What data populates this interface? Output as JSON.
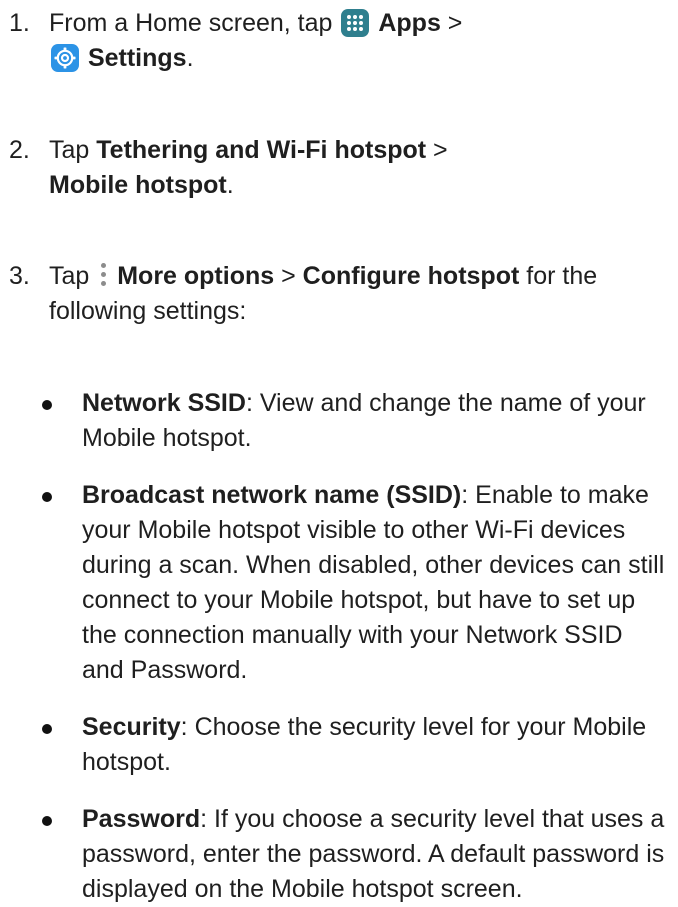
{
  "steps": [
    {
      "number": "1.",
      "prefix": "From a Home screen, tap",
      "apps_label": "Apps",
      "sep1": ">",
      "settings_label": "Settings",
      "end": "."
    },
    {
      "number": "2.",
      "prefix": "Tap",
      "bold1": "Tethering and Wi-Fi hotspot",
      "sep1": ">",
      "bold2": "Mobile hotspot",
      "end": "."
    },
    {
      "number": "3.",
      "prefix": "Tap",
      "bold1": "More options",
      "sep1": ">",
      "bold2": "Configure hotspot",
      "rest": "for the following settings:"
    }
  ],
  "bullets": [
    {
      "term": "Network SSID",
      "text": ": View and change the name of your Mobile hotspot."
    },
    {
      "term": "Broadcast network name (SSID)",
      "text": ": Enable to make your Mobile hotspot visible to other Wi-Fi devices during a scan. When disabled, other devices can still connect to your Mobile hotspot, but have to set up the connection manually with your Network SSID and Password."
    },
    {
      "term": "Security",
      "text": ": Choose the security level for your Mobile hotspot."
    },
    {
      "term": "Password",
      "text": ": If you choose a security level that uses a password, enter the password. A default password is displayed on the Mobile hotspot screen."
    }
  ],
  "icons": {
    "apps": "apps-grid-icon",
    "settings": "settings-gear-icon",
    "more": "more-options-icon"
  },
  "colors": {
    "apps_icon": "#2f7f8e",
    "settings_icon": "#2c93e6",
    "more_icon": "#8c8c8c",
    "text": "#1f1f1f"
  }
}
